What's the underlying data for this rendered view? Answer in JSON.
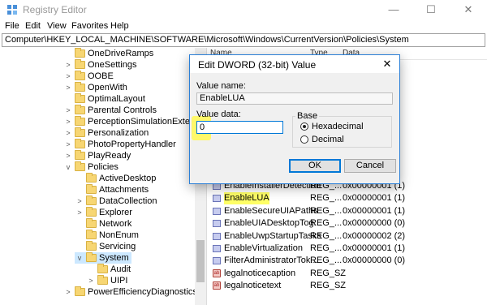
{
  "window": {
    "title": "Registry Editor",
    "minimize": "—",
    "maximize": "☐",
    "close": "✕"
  },
  "menu": [
    "File",
    "Edit",
    "View",
    "Favorites",
    "Help"
  ],
  "address": "Computer\\HKEY_LOCAL_MACHINE\\SOFTWARE\\Microsoft\\Windows\\CurrentVersion\\Policies\\System",
  "tree": [
    {
      "label": "OneDriveRamps",
      "level": 0,
      "chevron": ""
    },
    {
      "label": "OneSettings",
      "level": 0,
      "chevron": ">"
    },
    {
      "label": "OOBE",
      "level": 0,
      "chevron": ">"
    },
    {
      "label": "OpenWith",
      "level": 0,
      "chevron": ">"
    },
    {
      "label": "OptimalLayout",
      "level": 0,
      "chevron": ""
    },
    {
      "label": "Parental Controls",
      "level": 0,
      "chevron": ">"
    },
    {
      "label": "PerceptionSimulationExtension",
      "level": 0,
      "chevron": ">"
    },
    {
      "label": "Personalization",
      "level": 0,
      "chevron": ">"
    },
    {
      "label": "PhotoPropertyHandler",
      "level": 0,
      "chevron": ">"
    },
    {
      "label": "PlayReady",
      "level": 0,
      "chevron": ">"
    },
    {
      "label": "Policies",
      "level": 0,
      "chevron": "v"
    },
    {
      "label": "ActiveDesktop",
      "level": 1,
      "chevron": ""
    },
    {
      "label": "Attachments",
      "level": 1,
      "chevron": ""
    },
    {
      "label": "DataCollection",
      "level": 1,
      "chevron": ">"
    },
    {
      "label": "Explorer",
      "level": 1,
      "chevron": ">"
    },
    {
      "label": "Network",
      "level": 1,
      "chevron": ""
    },
    {
      "label": "NonEnum",
      "level": 1,
      "chevron": ""
    },
    {
      "label": "Servicing",
      "level": 1,
      "chevron": ""
    },
    {
      "label": "System",
      "level": 1,
      "chevron": "v",
      "selected": true
    },
    {
      "label": "Audit",
      "level": 2,
      "chevron": ""
    },
    {
      "label": "UIPI",
      "level": 2,
      "chevron": ">"
    },
    {
      "label": "PowerEfficiencyDiagnostics",
      "level": 0,
      "chevron": ">"
    }
  ],
  "list_headers": {
    "name": "Name",
    "type": "Type",
    "data": "Data"
  },
  "values": [
    {
      "name": "EnableInstallerDetection",
      "type": "REG_...",
      "data": "0x00000001 (1)",
      "icon": "dword"
    },
    {
      "name": "EnableLUA",
      "type": "REG_...",
      "data": "0x00000001 (1)",
      "icon": "dword",
      "highlight": true
    },
    {
      "name": "EnableSecureUIAPaths",
      "type": "REG_...",
      "data": "0x00000001 (1)",
      "icon": "dword"
    },
    {
      "name": "EnableUIADesktopTog...",
      "type": "REG_...",
      "data": "0x00000000 (0)",
      "icon": "dword"
    },
    {
      "name": "EnableUwpStartupTasks",
      "type": "REG_...",
      "data": "0x00000002 (2)",
      "icon": "dword"
    },
    {
      "name": "EnableVirtualization",
      "type": "REG_...",
      "data": "0x00000001 (1)",
      "icon": "dword"
    },
    {
      "name": "FilterAdministratorTok...",
      "type": "REG_...",
      "data": "0x00000000 (0)",
      "icon": "dword"
    },
    {
      "name": "legalnoticecaption",
      "type": "REG_SZ",
      "data": "",
      "icon": "sz"
    },
    {
      "name": "legalnoticetext",
      "type": "REG_SZ",
      "data": "",
      "icon": "sz"
    }
  ],
  "dialog": {
    "title": "Edit DWORD (32-bit) Value",
    "close": "✕",
    "value_name_label": "Value name:",
    "value_name": "EnableLUA",
    "value_data_label": "Value data:",
    "value_data": "0",
    "base_label": "Base",
    "hex_label": "Hexadecimal",
    "dec_label": "Decimal",
    "base_selected": "Hexadecimal",
    "ok_label": "OK",
    "cancel_label": "Cancel"
  },
  "colors": {
    "highlight": "#ffff66",
    "selection": "#cce8ff",
    "dialog_border": "#2b7fd6"
  }
}
